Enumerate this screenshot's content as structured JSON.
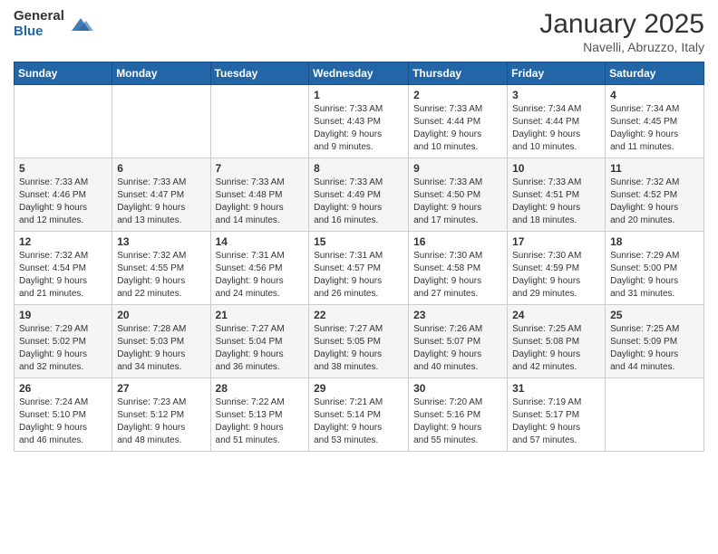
{
  "logo": {
    "general": "General",
    "blue": "Blue"
  },
  "title": "January 2025",
  "location": "Navelli, Abruzzo, Italy",
  "days_header": [
    "Sunday",
    "Monday",
    "Tuesday",
    "Wednesday",
    "Thursday",
    "Friday",
    "Saturday"
  ],
  "weeks": [
    [
      {
        "day": "",
        "info": ""
      },
      {
        "day": "",
        "info": ""
      },
      {
        "day": "",
        "info": ""
      },
      {
        "day": "1",
        "info": "Sunrise: 7:33 AM\nSunset: 4:43 PM\nDaylight: 9 hours\nand 9 minutes."
      },
      {
        "day": "2",
        "info": "Sunrise: 7:33 AM\nSunset: 4:44 PM\nDaylight: 9 hours\nand 10 minutes."
      },
      {
        "day": "3",
        "info": "Sunrise: 7:34 AM\nSunset: 4:44 PM\nDaylight: 9 hours\nand 10 minutes."
      },
      {
        "day": "4",
        "info": "Sunrise: 7:34 AM\nSunset: 4:45 PM\nDaylight: 9 hours\nand 11 minutes."
      }
    ],
    [
      {
        "day": "5",
        "info": "Sunrise: 7:33 AM\nSunset: 4:46 PM\nDaylight: 9 hours\nand 12 minutes."
      },
      {
        "day": "6",
        "info": "Sunrise: 7:33 AM\nSunset: 4:47 PM\nDaylight: 9 hours\nand 13 minutes."
      },
      {
        "day": "7",
        "info": "Sunrise: 7:33 AM\nSunset: 4:48 PM\nDaylight: 9 hours\nand 14 minutes."
      },
      {
        "day": "8",
        "info": "Sunrise: 7:33 AM\nSunset: 4:49 PM\nDaylight: 9 hours\nand 16 minutes."
      },
      {
        "day": "9",
        "info": "Sunrise: 7:33 AM\nSunset: 4:50 PM\nDaylight: 9 hours\nand 17 minutes."
      },
      {
        "day": "10",
        "info": "Sunrise: 7:33 AM\nSunset: 4:51 PM\nDaylight: 9 hours\nand 18 minutes."
      },
      {
        "day": "11",
        "info": "Sunrise: 7:32 AM\nSunset: 4:52 PM\nDaylight: 9 hours\nand 20 minutes."
      }
    ],
    [
      {
        "day": "12",
        "info": "Sunrise: 7:32 AM\nSunset: 4:54 PM\nDaylight: 9 hours\nand 21 minutes."
      },
      {
        "day": "13",
        "info": "Sunrise: 7:32 AM\nSunset: 4:55 PM\nDaylight: 9 hours\nand 22 minutes."
      },
      {
        "day": "14",
        "info": "Sunrise: 7:31 AM\nSunset: 4:56 PM\nDaylight: 9 hours\nand 24 minutes."
      },
      {
        "day": "15",
        "info": "Sunrise: 7:31 AM\nSunset: 4:57 PM\nDaylight: 9 hours\nand 26 minutes."
      },
      {
        "day": "16",
        "info": "Sunrise: 7:30 AM\nSunset: 4:58 PM\nDaylight: 9 hours\nand 27 minutes."
      },
      {
        "day": "17",
        "info": "Sunrise: 7:30 AM\nSunset: 4:59 PM\nDaylight: 9 hours\nand 29 minutes."
      },
      {
        "day": "18",
        "info": "Sunrise: 7:29 AM\nSunset: 5:00 PM\nDaylight: 9 hours\nand 31 minutes."
      }
    ],
    [
      {
        "day": "19",
        "info": "Sunrise: 7:29 AM\nSunset: 5:02 PM\nDaylight: 9 hours\nand 32 minutes."
      },
      {
        "day": "20",
        "info": "Sunrise: 7:28 AM\nSunset: 5:03 PM\nDaylight: 9 hours\nand 34 minutes."
      },
      {
        "day": "21",
        "info": "Sunrise: 7:27 AM\nSunset: 5:04 PM\nDaylight: 9 hours\nand 36 minutes."
      },
      {
        "day": "22",
        "info": "Sunrise: 7:27 AM\nSunset: 5:05 PM\nDaylight: 9 hours\nand 38 minutes."
      },
      {
        "day": "23",
        "info": "Sunrise: 7:26 AM\nSunset: 5:07 PM\nDaylight: 9 hours\nand 40 minutes."
      },
      {
        "day": "24",
        "info": "Sunrise: 7:25 AM\nSunset: 5:08 PM\nDaylight: 9 hours\nand 42 minutes."
      },
      {
        "day": "25",
        "info": "Sunrise: 7:25 AM\nSunset: 5:09 PM\nDaylight: 9 hours\nand 44 minutes."
      }
    ],
    [
      {
        "day": "26",
        "info": "Sunrise: 7:24 AM\nSunset: 5:10 PM\nDaylight: 9 hours\nand 46 minutes."
      },
      {
        "day": "27",
        "info": "Sunrise: 7:23 AM\nSunset: 5:12 PM\nDaylight: 9 hours\nand 48 minutes."
      },
      {
        "day": "28",
        "info": "Sunrise: 7:22 AM\nSunset: 5:13 PM\nDaylight: 9 hours\nand 51 minutes."
      },
      {
        "day": "29",
        "info": "Sunrise: 7:21 AM\nSunset: 5:14 PM\nDaylight: 9 hours\nand 53 minutes."
      },
      {
        "day": "30",
        "info": "Sunrise: 7:20 AM\nSunset: 5:16 PM\nDaylight: 9 hours\nand 55 minutes."
      },
      {
        "day": "31",
        "info": "Sunrise: 7:19 AM\nSunset: 5:17 PM\nDaylight: 9 hours\nand 57 minutes."
      },
      {
        "day": "",
        "info": ""
      }
    ]
  ]
}
